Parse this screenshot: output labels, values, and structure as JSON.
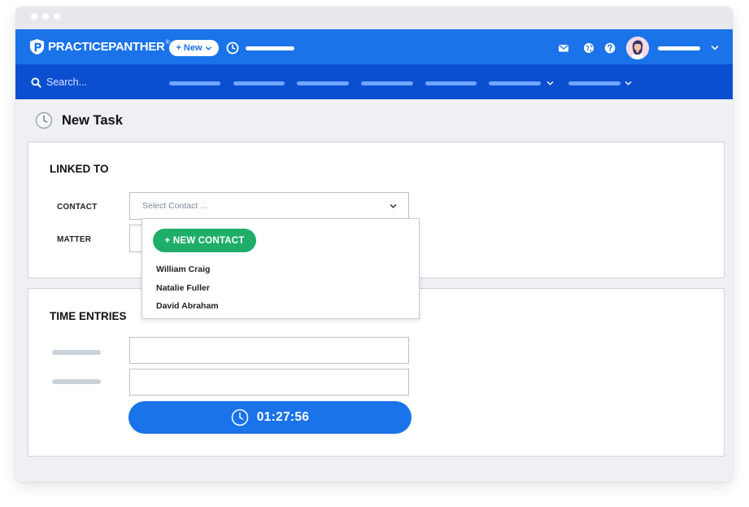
{
  "app": {
    "brand": "PRACTICEPANTHER",
    "brand_mark": "®",
    "new_button_label": "+ New"
  },
  "search": {
    "placeholder": "Search..."
  },
  "page": {
    "title": "New Task"
  },
  "linked_to": {
    "heading": "LINKED TO",
    "contact_label": "CONTACT",
    "contact_placeholder": "Select Contact ...",
    "matter_label": "MATTER"
  },
  "contact_dropdown": {
    "new_contact_label": "+ NEW CONTACT",
    "options": [
      "William Craig",
      "Natalie Fuller",
      "David Abraham"
    ]
  },
  "time_entries": {
    "heading": "TIME ENTRIES",
    "timer_value": "01:27:56"
  },
  "colors": {
    "primary_blue": "#1a73e8",
    "nav_blue": "#0b4fd0",
    "green": "#1fae6a"
  },
  "icons": [
    "panther-logo-icon",
    "chevron-down-icon",
    "clock-icon",
    "mail-icon",
    "globe-icon",
    "help-icon",
    "avatar",
    "search-icon"
  ]
}
